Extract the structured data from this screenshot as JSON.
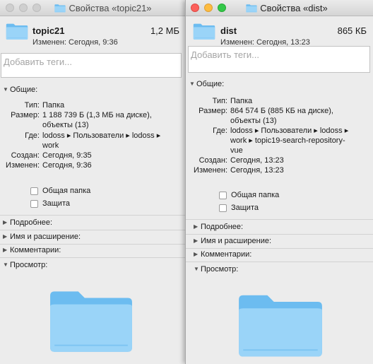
{
  "win1": {
    "title": "Свойства «topic21»",
    "name": "topic21",
    "size": "1,2 МБ",
    "modified": "Изменен: Сегодня, 9:36",
    "tags_placeholder": "Добавить теги...",
    "general": "Общие:",
    "labels": {
      "kind": "Тип:",
      "size": "Размер:",
      "where": "Где:",
      "created": "Создан:",
      "modified": "Изменен:"
    },
    "values": {
      "kind": "Папка",
      "size_1": "1 188 739 Б (1,3 МБ на диске),",
      "size_2": "объекты (13)",
      "where_1": "lodoss ▸ Пользователи ▸ lodoss ▸",
      "where_2": "work",
      "created": "Сегодня, 9:35",
      "modified": "Сегодня, 9:36"
    },
    "shared": "Общая папка",
    "locked": "Защита",
    "more": "Подробнее:",
    "name_ext": "Имя и расширение:",
    "comments": "Комментарии:",
    "preview": "Просмотр:"
  },
  "win2": {
    "title": "Свойства «dist»",
    "name": "dist",
    "size": "865 КБ",
    "modified": "Изменен: Сегодня, 13:23",
    "tags_placeholder": "Добавить теги...",
    "general": "Общие:",
    "labels": {
      "kind": "Тип:",
      "size": "Размер:",
      "where": "Где:",
      "created": "Создан:",
      "modified": "Изменен:"
    },
    "values": {
      "kind": "Папка",
      "size_1": "864 574 Б (885 КБ на диске),",
      "size_2": "объекты (13)",
      "where_1": "lodoss ▸ Пользователи ▸ lodoss ▸",
      "where_2": "work ▸ topic19-search-repository-",
      "where_3": "vue",
      "created": "Сегодня, 13:23",
      "modified": "Сегодня, 13:23"
    },
    "shared": "Общая папка",
    "locked": "Защита",
    "more": "Подробнее:",
    "name_ext": "Имя и расширение:",
    "comments": "Комментарии:",
    "preview": "Просмотр:"
  },
  "icons": {
    "folder": "folder-icon",
    "disclosure_open": "▼",
    "disclosure_closed": "▶"
  },
  "colors": {
    "folder_light": "#a9dcfb",
    "folder_dark": "#6cbcf0",
    "close": "#fc605b",
    "minimize": "#fdbc40",
    "zoom": "#34c84a",
    "inactive": "#cfcfcf"
  }
}
